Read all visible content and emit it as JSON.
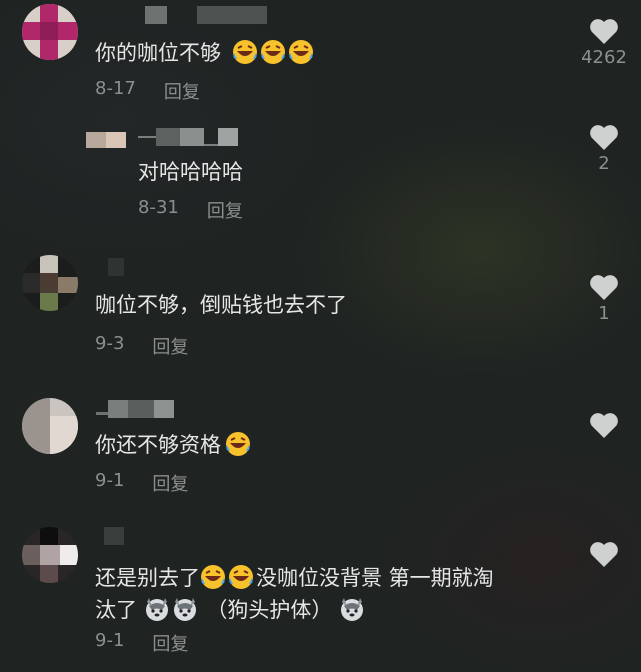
{
  "comments": [
    {
      "text": "你的咖位不够",
      "emoji_count": 3,
      "date": "8-17",
      "reply_label": "回复",
      "likes": "4262"
    },
    {
      "text": "对哈哈哈哈",
      "date": "8-31",
      "reply_label": "回复",
      "likes": "2"
    },
    {
      "text": "咖位不够，倒贴钱也去不了",
      "date": "9-3",
      "reply_label": "回复",
      "likes": "1"
    },
    {
      "text": "你还不够资格",
      "date": "9-1",
      "reply_label": "回复",
      "likes": ""
    },
    {
      "text_a": "还是别去了",
      "text_b": "没咖位没背景 第一期就淘",
      "text_c": "汰了",
      "text_d": "（狗头护体）",
      "date": "9-1",
      "reply_label": "回复",
      "likes": ""
    }
  ],
  "icons": {
    "like": "heart-icon",
    "laugh": "laughing-tears-emoji",
    "doge": "doge-emoji"
  },
  "colors": {
    "text": "#e6e6e6",
    "meta": "#8c8f8f",
    "heart": "#cfd1d1"
  }
}
